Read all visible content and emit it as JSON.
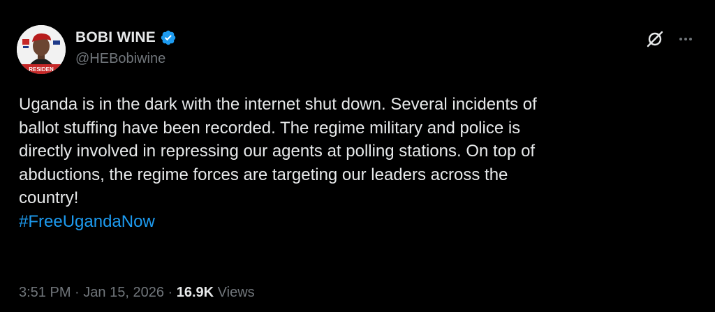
{
  "author": {
    "display_name": "BOBI WINE",
    "handle": "@HEBobiwine",
    "verified": true,
    "avatar_banner_text": "RESIDEN"
  },
  "actions": {
    "grok_icon": "grok-slash-icon",
    "more_icon": "more-horizontal-icon"
  },
  "tweet": {
    "text_lines": [
      "Uganda is in the dark with the internet shut down. Several incidents of",
      "ballot stuffing have been recorded. The regime military and police is",
      "directly involved in repressing our agents at polling stations. On top of",
      "abductions, the regime forces are targeting our leaders across the",
      "country!"
    ],
    "hashtag": "#FreeUgandaNow"
  },
  "meta": {
    "time": "3:51 PM",
    "separator": "·",
    "date": "Jan 15, 2026",
    "views_count": "16.9K",
    "views_label": "Views"
  },
  "colors": {
    "background": "#000000",
    "primary_text": "#e7e9ea",
    "secondary_text": "#71767b",
    "link": "#1d9bf0",
    "verified_badge": "#1d9bf0"
  }
}
